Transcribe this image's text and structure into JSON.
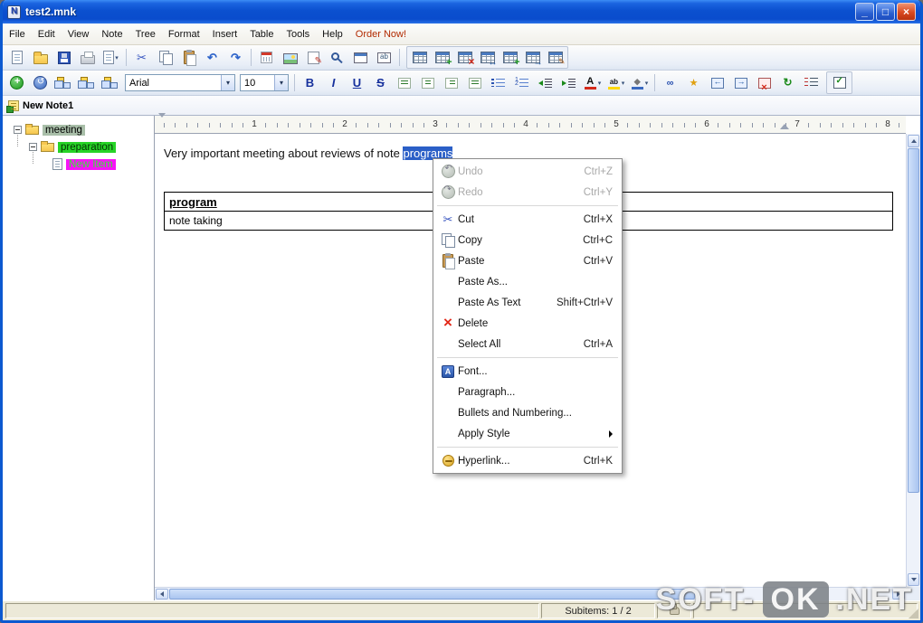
{
  "window": {
    "title": "test2.mnk",
    "minimize_glyph": "_",
    "maximize_glyph": "□",
    "close_glyph": "×"
  },
  "menubar": {
    "items": [
      "File",
      "Edit",
      "View",
      "Note",
      "Tree",
      "Format",
      "Insert",
      "Table",
      "Tools",
      "Help",
      "Order Now!"
    ]
  },
  "toolbar_standard": {
    "icons": [
      "new-document",
      "open-folder",
      "save",
      "print",
      "export",
      "cut",
      "copy",
      "paste",
      "undo",
      "redo",
      "insert-date",
      "insert-picture",
      "insert-object",
      "find",
      "show-panels",
      "insert-field",
      "insert-table",
      "insert-row",
      "delete-row",
      "split-cells",
      "insert-column",
      "merge-cells",
      "table-properties"
    ]
  },
  "toolbar_format": {
    "font_name": "Arial",
    "font_size": "10",
    "icons": [
      "new-note",
      "navigate-back",
      "tree-layout-1",
      "tree-layout-2",
      "tree-layout-3",
      "bold",
      "italic",
      "underline",
      "strikethrough",
      "align-left",
      "align-center",
      "align-right",
      "align-justify",
      "bullets",
      "numbering",
      "outdent",
      "indent",
      "font-color",
      "highlight",
      "fill-color",
      "insert-link",
      "new-child-note",
      "move-node-left",
      "move-node-right",
      "delete-note",
      "refresh",
      "styles-list",
      "checklist"
    ]
  },
  "tree": {
    "tab_label": "New Note1",
    "items": [
      {
        "label": "meeting",
        "bg": "#a9bfa9",
        "color": "#000000"
      },
      {
        "label": "preparation",
        "bg": "#27d427",
        "color": "#033303"
      },
      {
        "label": "New Item",
        "bg": "#f714f7",
        "color": "#39e639"
      }
    ]
  },
  "ruler": {
    "marks": [
      "1",
      "2",
      "3",
      "4",
      "5",
      "6",
      "7",
      "8"
    ]
  },
  "editor": {
    "text_before": "Very important meeting about reviews of note ",
    "selected_text": "programs"
  },
  "table": {
    "header": "program",
    "cell": "note taking"
  },
  "context_menu": {
    "items": [
      {
        "label": "Undo",
        "shortcut": "Ctrl+Z",
        "disabled": true,
        "icon": "undo-icon"
      },
      {
        "label": "Redo",
        "shortcut": "Ctrl+Y",
        "disabled": true,
        "icon": "redo-icon"
      },
      {
        "label": "Cut",
        "shortcut": "Ctrl+X",
        "icon": "cut-icon"
      },
      {
        "label": "Copy",
        "shortcut": "Ctrl+C",
        "icon": "copy-icon"
      },
      {
        "label": "Paste",
        "shortcut": "Ctrl+V",
        "icon": "paste-icon"
      },
      {
        "label": "Paste As...",
        "shortcut": ""
      },
      {
        "label": "Paste As Text",
        "shortcut": "Shift+Ctrl+V"
      },
      {
        "label": "Delete",
        "shortcut": "",
        "icon": "delete-icon"
      },
      {
        "label": "Select All",
        "shortcut": "Ctrl+A"
      },
      {
        "label": "Font...",
        "shortcut": "",
        "icon": "font-icon"
      },
      {
        "label": "Paragraph...",
        "shortcut": ""
      },
      {
        "label": "Bullets and Numbering...",
        "shortcut": ""
      },
      {
        "label": "Apply Style",
        "shortcut": "",
        "submenu": true
      },
      {
        "label": "Hyperlink...",
        "shortcut": "Ctrl+K",
        "icon": "hyperlink-icon"
      }
    ]
  },
  "statusbar": {
    "subitems_label": "Subitems: 1 / 2"
  },
  "watermark": {
    "left": "SOFT-",
    "badge": "OK",
    "right": ".NET"
  },
  "colors": {
    "titlebar": "#0b50cf",
    "close_button": "#d9481f",
    "selection": "#2b5fc7",
    "meeting_bg": "#a9bfa9",
    "preparation_bg": "#27d427",
    "new_item_bg": "#f714f7",
    "new_item_text": "#39e639"
  }
}
